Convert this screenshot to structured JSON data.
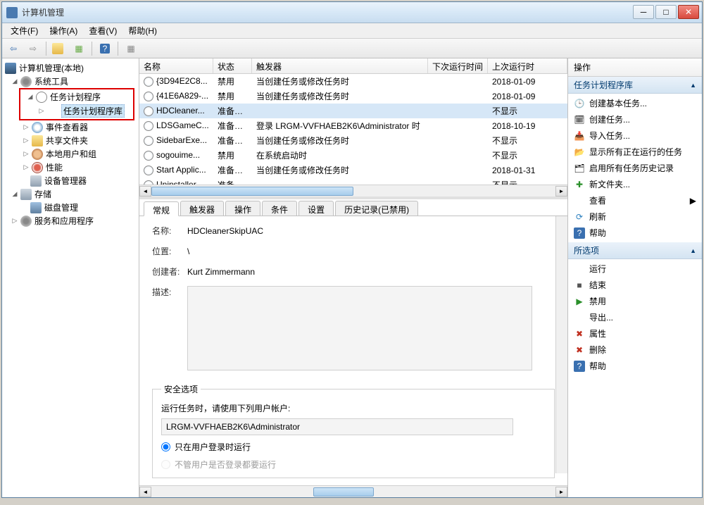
{
  "window": {
    "title": "计算机管理"
  },
  "menubar": {
    "file": "文件(F)",
    "action": "操作(A)",
    "view": "查看(V)",
    "help": "帮助(H)"
  },
  "tree": {
    "root": "计算机管理(本地)",
    "systools": "系统工具",
    "scheduler": "任务计划程序",
    "scheduler_lib": "任务计划程序库",
    "eventviewer": "事件查看器",
    "sharedfolders": "共享文件夹",
    "localusers": "本地用户和组",
    "performance": "性能",
    "devicemgr": "设备管理器",
    "storage": "存储",
    "diskmgmt": "磁盘管理",
    "services": "服务和应用程序"
  },
  "tasklist": {
    "cols": {
      "name": "名称",
      "status": "状态",
      "trigger": "触发器",
      "next_run": "下次运行时间",
      "last_run": "上次运行时"
    },
    "rows": [
      {
        "name": "{3D94E2C8...",
        "status": "禁用",
        "trigger": "当创建任务或修改任务时",
        "next_run": "",
        "last_run": "2018-01-09"
      },
      {
        "name": "{41E6A829-...",
        "status": "禁用",
        "trigger": "当创建任务或修改任务时",
        "next_run": "",
        "last_run": "2018-01-09"
      },
      {
        "name": "HDCleaner...",
        "status": "准备就绪",
        "trigger": "",
        "next_run": "",
        "last_run": "不显示"
      },
      {
        "name": "LDSGameC...",
        "status": "准备就绪",
        "trigger": "登录 LRGM-VVFHAEB2K6\\Administrator 时",
        "next_run": "",
        "last_run": "2018-10-19"
      },
      {
        "name": "SidebarExe...",
        "status": "准备就绪",
        "trigger": "当创建任务或修改任务时",
        "next_run": "",
        "last_run": "不显示"
      },
      {
        "name": "sogouime...",
        "status": "禁用",
        "trigger": "在系统启动时",
        "next_run": "",
        "last_run": "不显示"
      },
      {
        "name": "Start Applic...",
        "status": "准备就绪",
        "trigger": "当创建任务或修改任务时",
        "next_run": "",
        "last_run": "2018-01-31"
      },
      {
        "name": "Uninstaller_...",
        "status": "准备就绪",
        "trigger": "",
        "next_run": "",
        "last_run": "不显示"
      }
    ]
  },
  "detail": {
    "tabs": {
      "general": "常规",
      "triggers": "触发器",
      "actions": "操作",
      "conditions": "条件",
      "settings": "设置",
      "history": "历史记录(已禁用)"
    },
    "labels": {
      "name": "名称:",
      "location": "位置:",
      "author": "创建者:",
      "description": "描述:"
    },
    "values": {
      "name": "HDCleanerSkipUAC",
      "location": "\\",
      "author": "Kurt Zimmermann"
    },
    "security": {
      "title": "安全选项",
      "account_label": "运行任务时，请使用下列用户帐户:",
      "account": "LRGM-VVFHAEB2K6\\Administrator",
      "radio1": "只在用户登录时运行",
      "radio2": "不管用户是否登录都要运行"
    }
  },
  "actions": {
    "header": "操作",
    "section1_title": "任务计划程序库",
    "section1": {
      "create_basic": "创建基本任务...",
      "create": "创建任务...",
      "import": "导入任务...",
      "show_running": "显示所有正在运行的任务",
      "enable_history": "启用所有任务历史记录",
      "new_folder": "新文件夹...",
      "view": "查看",
      "refresh": "刷新",
      "help": "帮助"
    },
    "section2_title": "所选项",
    "section2": {
      "run": "运行",
      "end": "结束",
      "disable": "禁用",
      "export": "导出...",
      "properties": "属性",
      "delete": "删除",
      "help": "帮助"
    }
  }
}
